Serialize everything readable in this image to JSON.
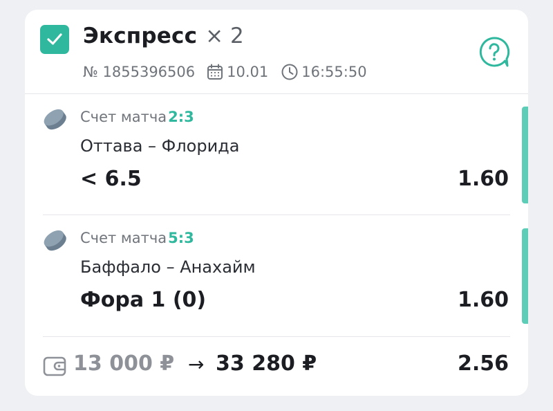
{
  "header": {
    "title": "Экспресс",
    "multiplier": "× 2",
    "bet_number": "№ 1855396506",
    "date": "10.01",
    "time": "16:55:50",
    "checkbox_icon": "check-icon",
    "help_icon": "question-icon"
  },
  "bets": [
    {
      "score_label": "Счет матча",
      "score": "2:3",
      "teams": "Оттава – Флорида",
      "outcome": "< 6.5",
      "odds": "1.60",
      "sport_icon": "hockey-puck-icon"
    },
    {
      "score_label": "Счет матча",
      "score": "5:3",
      "teams": "Баффало – Анахайм",
      "outcome": "Фора 1 (0)",
      "odds": "1.60",
      "sport_icon": "hockey-puck-icon"
    }
  ],
  "footer": {
    "stake": "13 000 ₽",
    "arrow": "→",
    "payout": "33 280 ₽",
    "total_odds": "2.56",
    "wallet_icon": "wallet-icon"
  },
  "colors": {
    "accent": "#2fb89d",
    "side_bar": "#5ecdb8",
    "background": "#eef0f3",
    "card": "#ffffff",
    "muted_text": "#70747b"
  }
}
